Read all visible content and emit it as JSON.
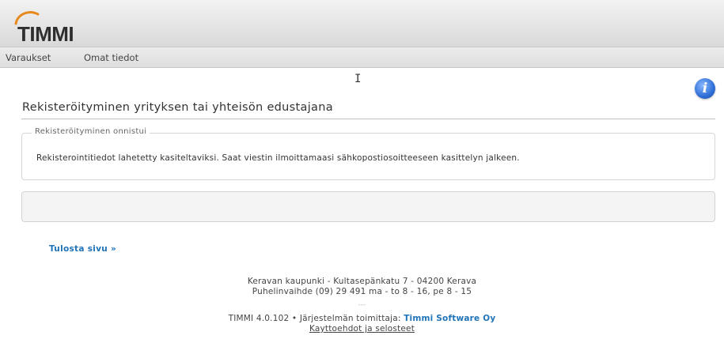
{
  "header": {
    "logo_text": "TIMMI"
  },
  "nav": {
    "items": [
      {
        "label": "Varaukset"
      },
      {
        "label": "Omat tiedot"
      }
    ]
  },
  "page": {
    "title": "Rekisteröityminen yrityksen tai yhteisön edustajana",
    "fieldset_legend": "Rekisteröityminen onnistui",
    "message": "Rekisterointitiedot lahetetty kasiteltaviksi. Saat viestin ilmoittamaasi sähkopostiosoitteeseen kasittelyn jalkeen.",
    "print_link": "Tulosta sivu »"
  },
  "footer": {
    "address_line": "Keravan kaupunki - Kultasepänkatu 7 - 04200 Kerava",
    "phone_line": "Puhelinvaihde (09) 29 491 ma - to 8 - 16, pe 8 - 15",
    "separator": "---",
    "version_prefix": "TIMMI 4.0.102 • Järjestelmän toimittaja: ",
    "vendor": "Timmi Software Oy",
    "terms_link": "Kayttoehdot ja selosteet"
  },
  "icons": {
    "info": "info-icon",
    "logo_swoosh": "logo-swoosh-icon"
  },
  "colors": {
    "link_blue": "#1f73b8",
    "swoosh_orange": "#e8891c",
    "info_blue": "#2f6fd6"
  }
}
